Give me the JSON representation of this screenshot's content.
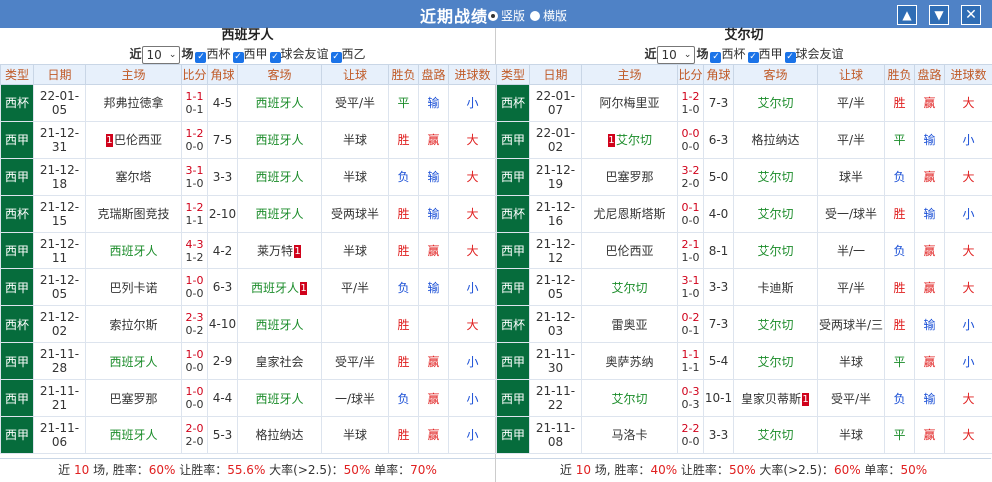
{
  "window": {
    "title": "近期战绩",
    "view_vertical": "竖版",
    "view_horizontal": "横版",
    "up_icon": "arrow-up-icon",
    "down_icon": "arrow-down-icon",
    "close_icon": "close-icon"
  },
  "colors": {
    "titlebar": "#4f82c6",
    "type_bg": "#066c3c",
    "win": "#e02020",
    "loss": "#1a4fd6",
    "draw": "#1b8c2a"
  },
  "headers": [
    "类型",
    "日期",
    "主场",
    "比分",
    "角球",
    "客场",
    "让球",
    "胜负",
    "盘路",
    "进球数"
  ],
  "left": {
    "team": "西班牙人",
    "recent_label": "近",
    "recent_count": "10",
    "match_unit": "场",
    "filters": [
      "西杯",
      "西甲",
      "球会友谊",
      "西乙"
    ],
    "rows": [
      {
        "type": "西杯",
        "date": "22-01-05",
        "home": "邦弗拉徳拿",
        "home_card": "",
        "score1": "1-1",
        "score2": "0-1",
        "corner": "4-5",
        "away": "西班牙人",
        "away_card": "",
        "handicap": "受平/半",
        "result": "平",
        "pan": "输",
        "goals": "小",
        "home_hl": false,
        "away_hl": true,
        "rc": "green",
        "pc": "blue",
        "gc": "blue"
      },
      {
        "type": "西甲",
        "date": "21-12-31",
        "home": "巴伦西亚",
        "home_card": "1",
        "score1": "1-2",
        "score2": "0-0",
        "corner": "7-5",
        "away": "西班牙人",
        "away_card": "",
        "handicap": "半球",
        "result": "胜",
        "pan": "赢",
        "goals": "大",
        "home_hl": false,
        "away_hl": true,
        "rc": "red",
        "pc": "red",
        "gc": "red"
      },
      {
        "type": "西甲",
        "date": "21-12-18",
        "home": "塞尔塔",
        "home_card": "",
        "score1": "3-1",
        "score2": "1-0",
        "corner": "3-3",
        "away": "西班牙人",
        "away_card": "",
        "handicap": "半球",
        "result": "负",
        "pan": "输",
        "goals": "大",
        "home_hl": false,
        "away_hl": true,
        "rc": "blue",
        "pc": "blue",
        "gc": "red"
      },
      {
        "type": "西杯",
        "date": "21-12-15",
        "home": "克瑞斯图竞技",
        "home_card": "",
        "score1": "1-2",
        "score2": "1-1",
        "corner": "2-10",
        "away": "西班牙人",
        "away_card": "",
        "handicap": "受两球半",
        "result": "胜",
        "pan": "输",
        "goals": "大",
        "home_hl": false,
        "away_hl": true,
        "rc": "red",
        "pc": "blue",
        "gc": "red"
      },
      {
        "type": "西甲",
        "date": "21-12-11",
        "home": "西班牙人",
        "home_card": "",
        "score1": "4-3",
        "score2": "1-2",
        "corner": "4-2",
        "away": "莱万特",
        "away_card": "1",
        "handicap": "半球",
        "result": "胜",
        "pan": "赢",
        "goals": "大",
        "home_hl": true,
        "away_hl": false,
        "rc": "red",
        "pc": "red",
        "gc": "red"
      },
      {
        "type": "西甲",
        "date": "21-12-05",
        "home": "巴列卡诺",
        "home_card": "",
        "score1": "1-0",
        "score2": "0-0",
        "corner": "6-3",
        "away": "西班牙人",
        "away_card": "1",
        "handicap": "平/半",
        "result": "负",
        "pan": "输",
        "goals": "小",
        "home_hl": false,
        "away_hl": true,
        "rc": "blue",
        "pc": "blue",
        "gc": "blue"
      },
      {
        "type": "西杯",
        "date": "21-12-02",
        "home": "索拉尔斯",
        "home_card": "",
        "score1": "2-3",
        "score2": "0-2",
        "corner": "4-10",
        "away": "西班牙人",
        "away_card": "",
        "handicap": "",
        "result": "胜",
        "pan": "",
        "goals": "大",
        "home_hl": false,
        "away_hl": true,
        "rc": "red",
        "pc": "red",
        "gc": "red"
      },
      {
        "type": "西甲",
        "date": "21-11-28",
        "home": "西班牙人",
        "home_card": "",
        "score1": "1-0",
        "score2": "0-0",
        "corner": "2-9",
        "away": "皇家社会",
        "away_card": "",
        "handicap": "受平/半",
        "result": "胜",
        "pan": "赢",
        "goals": "小",
        "home_hl": true,
        "away_hl": false,
        "rc": "red",
        "pc": "red",
        "gc": "blue"
      },
      {
        "type": "西甲",
        "date": "21-11-21",
        "home": "巴塞罗那",
        "home_card": "",
        "score1": "1-0",
        "score2": "0-0",
        "corner": "4-4",
        "away": "西班牙人",
        "away_card": "",
        "handicap": "一/球半",
        "result": "负",
        "pan": "赢",
        "goals": "小",
        "home_hl": false,
        "away_hl": true,
        "rc": "blue",
        "pc": "red",
        "gc": "blue"
      },
      {
        "type": "西甲",
        "date": "21-11-06",
        "home": "西班牙人",
        "home_card": "",
        "score1": "2-0",
        "score2": "2-0",
        "corner": "5-3",
        "away": "格拉纳达",
        "away_card": "",
        "handicap": "半球",
        "result": "胜",
        "pan": "赢",
        "goals": "小",
        "home_hl": true,
        "away_hl": false,
        "rc": "red",
        "pc": "red",
        "gc": "blue"
      }
    ],
    "summary": {
      "p1": "近 ",
      "count": "10",
      "p2": " 场, 胜率：",
      "win": "60%",
      "p3": " 让胜率：",
      "hwin": "55.6%",
      "p4": " 大率(>2.5)：",
      "over": "50%",
      "p5": " 单率：",
      "odd": "70%"
    }
  },
  "right": {
    "team": "艾尔切",
    "recent_label": "近",
    "recent_count": "10",
    "match_unit": "场",
    "filters": [
      "西杯",
      "西甲",
      "球会友谊"
    ],
    "rows": [
      {
        "type": "西杯",
        "date": "22-01-07",
        "home": "阿尔梅里亚",
        "home_card": "",
        "score1": "1-2",
        "score2": "1-0",
        "corner": "7-3",
        "away": "艾尔切",
        "away_card": "",
        "handicap": "平/半",
        "result": "胜",
        "pan": "赢",
        "goals": "大",
        "home_hl": false,
        "away_hl": true,
        "rc": "red",
        "pc": "red",
        "gc": "red"
      },
      {
        "type": "西甲",
        "date": "22-01-02",
        "home": "艾尔切",
        "home_card": "1",
        "score1": "0-0",
        "score2": "0-0",
        "corner": "6-3",
        "away": "格拉纳达",
        "away_card": "",
        "handicap": "平/半",
        "result": "平",
        "pan": "输",
        "goals": "小",
        "home_hl": true,
        "away_hl": false,
        "rc": "green",
        "pc": "blue",
        "gc": "blue"
      },
      {
        "type": "西甲",
        "date": "21-12-19",
        "home": "巴塞罗那",
        "home_card": "",
        "score1": "3-2",
        "score2": "2-0",
        "corner": "5-0",
        "away": "艾尔切",
        "away_card": "",
        "handicap": "球半",
        "result": "负",
        "pan": "赢",
        "goals": "大",
        "home_hl": false,
        "away_hl": true,
        "rc": "blue",
        "pc": "red",
        "gc": "red"
      },
      {
        "type": "西杯",
        "date": "21-12-16",
        "home": "尤尼恩斯塔斯",
        "home_card": "",
        "score1": "0-1",
        "score2": "0-0",
        "corner": "4-0",
        "away": "艾尔切",
        "away_card": "",
        "handicap": "受一/球半",
        "result": "胜",
        "pan": "输",
        "goals": "小",
        "home_hl": false,
        "away_hl": true,
        "rc": "red",
        "pc": "blue",
        "gc": "blue"
      },
      {
        "type": "西甲",
        "date": "21-12-12",
        "home": "巴伦西亚",
        "home_card": "",
        "score1": "2-1",
        "score2": "1-0",
        "corner": "8-1",
        "away": "艾尔切",
        "away_card": "",
        "handicap": "半/一",
        "result": "负",
        "pan": "赢",
        "goals": "大",
        "home_hl": false,
        "away_hl": true,
        "rc": "blue",
        "pc": "red",
        "gc": "red"
      },
      {
        "type": "西甲",
        "date": "21-12-05",
        "home": "艾尔切",
        "home_card": "",
        "score1": "3-1",
        "score2": "1-0",
        "corner": "3-3",
        "away": "卡迪斯",
        "away_card": "",
        "handicap": "平/半",
        "result": "胜",
        "pan": "赢",
        "goals": "大",
        "home_hl": true,
        "away_hl": false,
        "rc": "red",
        "pc": "red",
        "gc": "red"
      },
      {
        "type": "西杯",
        "date": "21-12-03",
        "home": "雷奥亚",
        "home_card": "",
        "score1": "0-2",
        "score2": "0-1",
        "corner": "7-3",
        "away": "艾尔切",
        "away_card": "",
        "handicap": "受两球半/三",
        "result": "胜",
        "pan": "输",
        "goals": "小",
        "home_hl": false,
        "away_hl": true,
        "rc": "red",
        "pc": "blue",
        "gc": "blue"
      },
      {
        "type": "西甲",
        "date": "21-11-30",
        "home": "奥萨苏纳",
        "home_card": "",
        "score1": "1-1",
        "score2": "1-1",
        "corner": "5-4",
        "away": "艾尔切",
        "away_card": "",
        "handicap": "半球",
        "result": "平",
        "pan": "赢",
        "goals": "小",
        "home_hl": false,
        "away_hl": true,
        "rc": "green",
        "pc": "red",
        "gc": "blue"
      },
      {
        "type": "西甲",
        "date": "21-11-22",
        "home": "艾尔切",
        "home_card": "",
        "score1": "0-3",
        "score2": "0-3",
        "corner": "10-1",
        "away": "皇家贝蒂斯",
        "away_card": "1",
        "handicap": "受平/半",
        "result": "负",
        "pan": "输",
        "goals": "大",
        "home_hl": true,
        "away_hl": false,
        "rc": "blue",
        "pc": "blue",
        "gc": "red"
      },
      {
        "type": "西甲",
        "date": "21-11-08",
        "home": "马洛卡",
        "home_card": "",
        "score1": "2-2",
        "score2": "0-0",
        "corner": "3-3",
        "away": "艾尔切",
        "away_card": "",
        "handicap": "半球",
        "result": "平",
        "pan": "赢",
        "goals": "大",
        "home_hl": false,
        "away_hl": true,
        "rc": "green",
        "pc": "red",
        "gc": "red"
      }
    ],
    "summary": {
      "p1": "近 ",
      "count": "10",
      "p2": " 场, 胜率：",
      "win": "40%",
      "p3": " 让胜率：",
      "hwin": "50%",
      "p4": " 大率(>2.5)：",
      "over": "60%",
      "p5": " 单率：",
      "odd": "50%"
    }
  }
}
